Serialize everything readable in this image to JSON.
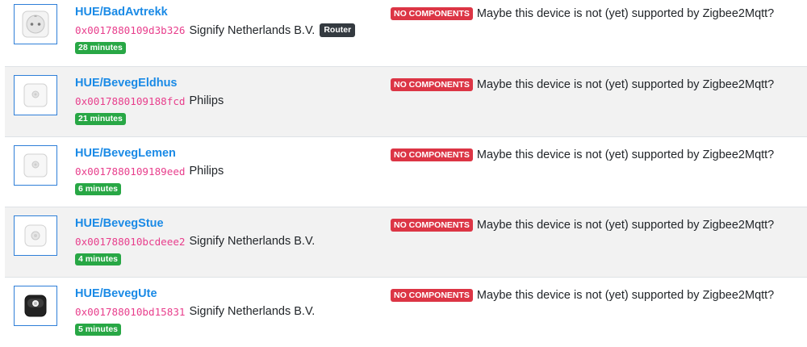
{
  "devices": [
    {
      "name": "HUE/BadAvtrekk",
      "ieee": "0x0017880109d3b326",
      "vendor": "Signify Netherlands B.V.",
      "type_badge": "Router",
      "last_seen": "28 minutes",
      "status_badge": "NO COMPONENTS",
      "status_message": "Maybe this device is not (yet) supported by Zigbee2Mqtt?",
      "image_icon": "smart-plug-icon"
    },
    {
      "name": "HUE/BevegEldhus",
      "ieee": "0x0017880109188fcd",
      "vendor": "Philips",
      "last_seen": "21 minutes",
      "status_badge": "NO COMPONENTS",
      "status_message": "Maybe this device is not (yet) supported by Zigbee2Mqtt?",
      "image_icon": "motion-sensor-icon"
    },
    {
      "name": "HUE/BevegLemen",
      "ieee": "0x0017880109189eed",
      "vendor": "Philips",
      "last_seen": "6 minutes",
      "status_badge": "NO COMPONENTS",
      "status_message": "Maybe this device is not (yet) supported by Zigbee2Mqtt?",
      "image_icon": "motion-sensor-icon"
    },
    {
      "name": "HUE/BevegStue",
      "ieee": "0x001788010bcdeee2",
      "vendor": "Signify Netherlands B.V.",
      "last_seen": "4 minutes",
      "status_badge": "NO COMPONENTS",
      "status_message": "Maybe this device is not (yet) supported by Zigbee2Mqtt?",
      "image_icon": "motion-sensor-icon"
    },
    {
      "name": "HUE/BevegUte",
      "ieee": "0x001788010bd15831",
      "vendor": "Signify Netherlands B.V.",
      "last_seen": "5 minutes",
      "status_badge": "NO COMPONENTS",
      "status_message": "Maybe this device is not (yet) supported by Zigbee2Mqtt?",
      "image_icon": "outdoor-motion-sensor-icon"
    }
  ],
  "colors": {
    "link": "#1a8ae6",
    "ieee": "#e83e8c",
    "last_seen_badge": "#28a745",
    "status_badge": "#dc3545",
    "router_badge": "#343a40",
    "stripe": "#f2f2f2"
  }
}
